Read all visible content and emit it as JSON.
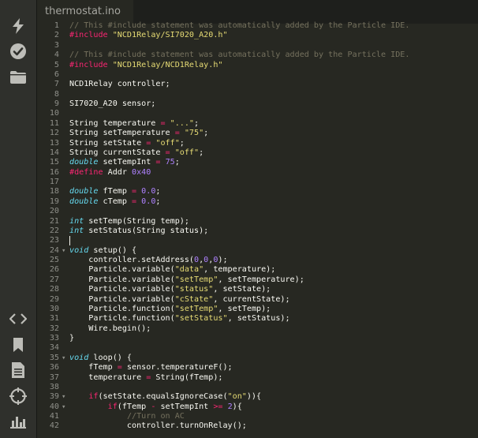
{
  "tab": {
    "title": "thermostat.ino"
  },
  "sidebar": {
    "top": [
      {
        "icon": "flash-icon"
      },
      {
        "icon": "verify-icon"
      },
      {
        "icon": "folder-icon"
      }
    ],
    "bottom": [
      {
        "icon": "code-icon"
      },
      {
        "icon": "libraries-icon"
      },
      {
        "icon": "docs-icon"
      },
      {
        "icon": "devices-icon"
      },
      {
        "icon": "console-icon"
      }
    ]
  },
  "editor": {
    "caret_line": 23,
    "lines": [
      {
        "n": "1",
        "tokens": [
          [
            "comment",
            "// This #include statement was automatically added by the Particle IDE."
          ]
        ]
      },
      {
        "n": "2",
        "tokens": [
          [
            "kw",
            "#include "
          ],
          [
            "str",
            "\"NCD1Relay/SI7020_A20.h\""
          ]
        ]
      },
      {
        "n": "3",
        "tokens": []
      },
      {
        "n": "4",
        "tokens": [
          [
            "comment",
            "// This #include statement was automatically added by the Particle IDE."
          ]
        ]
      },
      {
        "n": "5",
        "tokens": [
          [
            "kw",
            "#include "
          ],
          [
            "str",
            "\"NCD1Relay/NCD1Relay.h\""
          ]
        ]
      },
      {
        "n": "6",
        "tokens": []
      },
      {
        "n": "7",
        "tokens": [
          [
            "plain",
            "NCD1Relay controller;"
          ]
        ]
      },
      {
        "n": "8",
        "tokens": []
      },
      {
        "n": "9",
        "tokens": [
          [
            "plain",
            "SI7020_A20 sensor;"
          ]
        ]
      },
      {
        "n": "10",
        "tokens": []
      },
      {
        "n": "11",
        "tokens": [
          [
            "plain",
            "String temperature "
          ],
          [
            "kw",
            "="
          ],
          [
            "plain",
            " "
          ],
          [
            "str",
            "\"...\""
          ],
          [
            "plain",
            ";"
          ]
        ]
      },
      {
        "n": "12",
        "tokens": [
          [
            "plain",
            "String setTemperature "
          ],
          [
            "kw",
            "="
          ],
          [
            "plain",
            " "
          ],
          [
            "str",
            "\"75\""
          ],
          [
            "plain",
            ";"
          ]
        ]
      },
      {
        "n": "13",
        "tokens": [
          [
            "plain",
            "String setState "
          ],
          [
            "kw",
            "="
          ],
          [
            "plain",
            " "
          ],
          [
            "str",
            "\"off\""
          ],
          [
            "plain",
            ";"
          ]
        ]
      },
      {
        "n": "14",
        "tokens": [
          [
            "plain",
            "String currentState "
          ],
          [
            "kw",
            "="
          ],
          [
            "plain",
            " "
          ],
          [
            "str",
            "\"off\""
          ],
          [
            "plain",
            ";"
          ]
        ]
      },
      {
        "n": "15",
        "tokens": [
          [
            "type",
            "double"
          ],
          [
            "plain",
            " setTempInt "
          ],
          [
            "kw",
            "="
          ],
          [
            "plain",
            " "
          ],
          [
            "num",
            "75"
          ],
          [
            "plain",
            ";"
          ]
        ]
      },
      {
        "n": "16",
        "tokens": [
          [
            "kw",
            "#define "
          ],
          [
            "plain",
            "Addr "
          ],
          [
            "num",
            "0x40"
          ]
        ]
      },
      {
        "n": "17",
        "tokens": []
      },
      {
        "n": "18",
        "tokens": [
          [
            "type",
            "double"
          ],
          [
            "plain",
            " fTemp "
          ],
          [
            "kw",
            "="
          ],
          [
            "plain",
            " "
          ],
          [
            "num",
            "0.0"
          ],
          [
            "plain",
            ";"
          ]
        ]
      },
      {
        "n": "19",
        "tokens": [
          [
            "type",
            "double"
          ],
          [
            "plain",
            " cTemp "
          ],
          [
            "kw",
            "="
          ],
          [
            "plain",
            " "
          ],
          [
            "num",
            "0.0"
          ],
          [
            "plain",
            ";"
          ]
        ]
      },
      {
        "n": "20",
        "tokens": []
      },
      {
        "n": "21",
        "tokens": [
          [
            "type",
            "int"
          ],
          [
            "plain",
            " setTemp(String temp);"
          ]
        ]
      },
      {
        "n": "22",
        "tokens": [
          [
            "type",
            "int"
          ],
          [
            "plain",
            " setStatus(String status);"
          ]
        ]
      },
      {
        "n": "23",
        "tokens": []
      },
      {
        "n": "24",
        "fold": true,
        "tokens": [
          [
            "type",
            "void"
          ],
          [
            "plain",
            " setup() {"
          ]
        ]
      },
      {
        "n": "25",
        "tokens": [
          [
            "plain",
            "    controller.setAddress("
          ],
          [
            "num",
            "0"
          ],
          [
            "plain",
            ","
          ],
          [
            "num",
            "0"
          ],
          [
            "plain",
            ","
          ],
          [
            "num",
            "0"
          ],
          [
            "plain",
            ");"
          ]
        ]
      },
      {
        "n": "26",
        "tokens": [
          [
            "plain",
            "    Particle.variable("
          ],
          [
            "str",
            "\"data\""
          ],
          [
            "plain",
            ", temperature);"
          ]
        ]
      },
      {
        "n": "27",
        "tokens": [
          [
            "plain",
            "    Particle.variable("
          ],
          [
            "str",
            "\"setTemp\""
          ],
          [
            "plain",
            ", setTemperature);"
          ]
        ]
      },
      {
        "n": "28",
        "tokens": [
          [
            "plain",
            "    Particle.variable("
          ],
          [
            "str",
            "\"status\""
          ],
          [
            "plain",
            ", setState);"
          ]
        ]
      },
      {
        "n": "29",
        "tokens": [
          [
            "plain",
            "    Particle.variable("
          ],
          [
            "str",
            "\"cState\""
          ],
          [
            "plain",
            ", currentState);"
          ]
        ]
      },
      {
        "n": "30",
        "tokens": [
          [
            "plain",
            "    Particle.function("
          ],
          [
            "str",
            "\"setTemp\""
          ],
          [
            "plain",
            ", setTemp);"
          ]
        ]
      },
      {
        "n": "31",
        "tokens": [
          [
            "plain",
            "    Particle.function("
          ],
          [
            "str",
            "\"setStatus\""
          ],
          [
            "plain",
            ", setStatus);"
          ]
        ]
      },
      {
        "n": "32",
        "tokens": [
          [
            "plain",
            "    Wire.begin();"
          ]
        ]
      },
      {
        "n": "33",
        "tokens": [
          [
            "plain",
            "}"
          ]
        ]
      },
      {
        "n": "34",
        "tokens": []
      },
      {
        "n": "35",
        "fold": true,
        "tokens": [
          [
            "type",
            "void"
          ],
          [
            "plain",
            " loop() {"
          ]
        ]
      },
      {
        "n": "36",
        "tokens": [
          [
            "plain",
            "    fTemp "
          ],
          [
            "kw",
            "="
          ],
          [
            "plain",
            " sensor.temperatureF();"
          ]
        ]
      },
      {
        "n": "37",
        "tokens": [
          [
            "plain",
            "    temperature "
          ],
          [
            "kw",
            "="
          ],
          [
            "plain",
            " String(fTemp);"
          ]
        ]
      },
      {
        "n": "38",
        "tokens": []
      },
      {
        "n": "39",
        "fold": true,
        "tokens": [
          [
            "plain",
            "    "
          ],
          [
            "kw",
            "if"
          ],
          [
            "plain",
            "(setState.equalsIgnoreCase("
          ],
          [
            "str",
            "\"on\""
          ],
          [
            "plain",
            ")){"
          ]
        ]
      },
      {
        "n": "40",
        "fold": true,
        "tokens": [
          [
            "plain",
            "        "
          ],
          [
            "kw",
            "if"
          ],
          [
            "plain",
            "(fTemp "
          ],
          [
            "kw",
            "-"
          ],
          [
            "plain",
            " setTempInt "
          ],
          [
            "kw",
            ">="
          ],
          [
            "plain",
            " "
          ],
          [
            "num",
            "2"
          ],
          [
            "plain",
            "){"
          ]
        ]
      },
      {
        "n": "41",
        "tokens": [
          [
            "plain",
            "            "
          ],
          [
            "comment",
            "//Turn on AC"
          ]
        ]
      },
      {
        "n": "42",
        "tokens": [
          [
            "plain",
            "            controller.turnOnRelay();"
          ]
        ]
      }
    ]
  }
}
